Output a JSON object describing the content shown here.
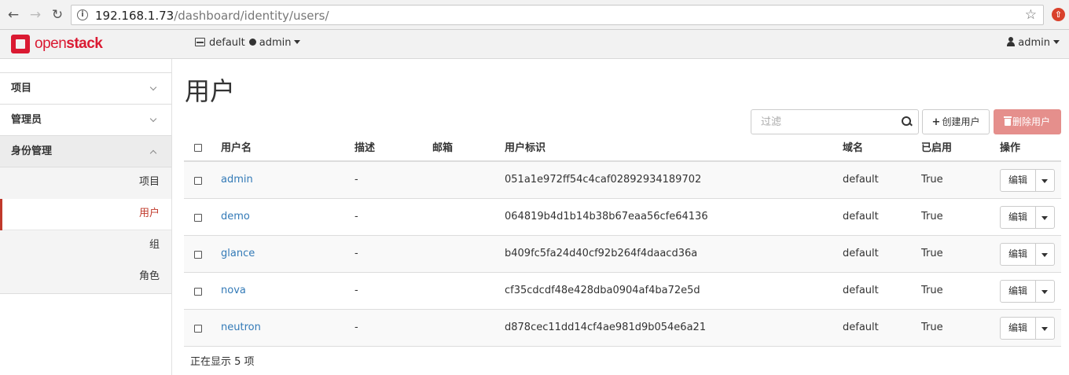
{
  "browser": {
    "url_host": "192.168.1.73",
    "url_path": "/dashboard/identity/users/"
  },
  "header": {
    "logo_prefix": "open",
    "logo_suffix": "stack",
    "project": "default",
    "project_user": "admin",
    "user": "admin"
  },
  "sidebar": {
    "sections": [
      {
        "label": "项目",
        "open": false
      },
      {
        "label": "管理员",
        "open": false
      },
      {
        "label": "身份管理",
        "open": true
      }
    ],
    "items": [
      {
        "label": "项目",
        "active": false
      },
      {
        "label": "用户",
        "active": true
      },
      {
        "label": "组",
        "active": false
      },
      {
        "label": "角色",
        "active": false
      }
    ]
  },
  "main": {
    "title": "用户",
    "filter_placeholder": "过滤",
    "create_label": "创建用户",
    "delete_label": "删除用户",
    "columns": [
      "用户名",
      "描述",
      "邮箱",
      "用户标识",
      "域名",
      "已启用",
      "操作"
    ],
    "rows": [
      {
        "name": "admin",
        "desc": "-",
        "email": "",
        "id": "051a1e972ff54c4caf02892934189702",
        "domain": "default",
        "enabled": "True",
        "action": "编辑"
      },
      {
        "name": "demo",
        "desc": "-",
        "email": "",
        "id": "064819b4d1b14b38b67eaa56cfe64136",
        "domain": "default",
        "enabled": "True",
        "action": "编辑"
      },
      {
        "name": "glance",
        "desc": "-",
        "email": "",
        "id": "b409fc5fa24d40cf92b264f4daacd36a",
        "domain": "default",
        "enabled": "True",
        "action": "编辑"
      },
      {
        "name": "nova",
        "desc": "-",
        "email": "",
        "id": "cf35cdcdf48e428dba0904af4ba72e5d",
        "domain": "default",
        "enabled": "True",
        "action": "编辑"
      },
      {
        "name": "neutron",
        "desc": "-",
        "email": "",
        "id": "d878cec11dd14cf4ae981d9b054e6a21",
        "domain": "default",
        "enabled": "True",
        "action": "编辑"
      }
    ],
    "footer": "正在显示 5 项"
  },
  "colors": {
    "brand": "#da1a32",
    "active": "#c0392b",
    "link": "#337ab7",
    "danger": "#e58f8c"
  }
}
